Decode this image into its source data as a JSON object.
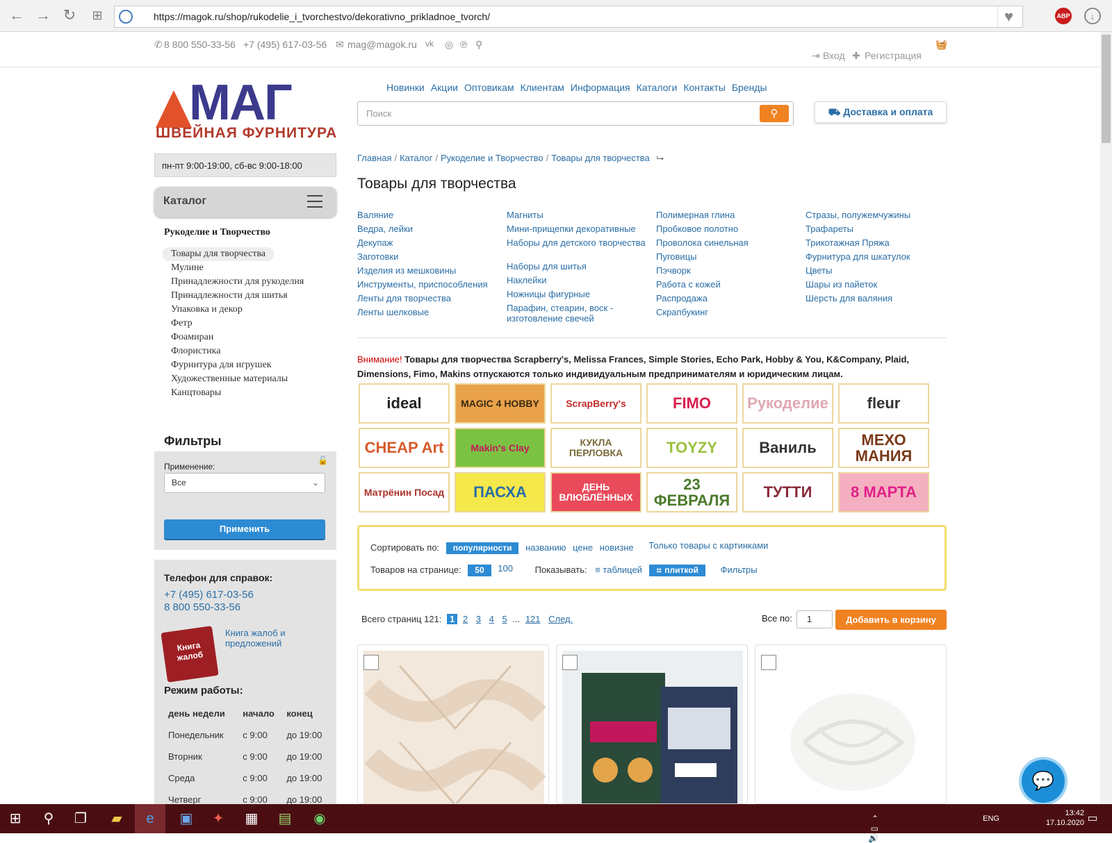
{
  "browser": {
    "url": "https://magok.ru/shop/rukodelie_i_tvorchestvo/dekorativno_prikladnoe_tvorch/",
    "abp_label": "ABP"
  },
  "topbar": {
    "phone1": "8 800 550-33-56",
    "phone2": "+7 (495) 617-03-56",
    "email": "mag@magok.ru",
    "login": "Вход",
    "register": "Регистрация"
  },
  "logo": {
    "main": "МАГ",
    "sub": "ШВЕЙНАЯ ФУРНИТУРА"
  },
  "mainmenu": [
    "Новинки",
    "Акции",
    "Оптовикам",
    "Клиентам",
    "Информация",
    "Каталоги",
    "Контакты",
    "Бренды"
  ],
  "search": {
    "placeholder": "Поиск"
  },
  "delivery": "Доставка и оплата",
  "hours": "пн-пт 9:00-19:00, сб-вс 9:00-18:00",
  "catalog": {
    "label": "Каталог"
  },
  "sidebar": {
    "title": "Рукоделие и Творчество",
    "items": [
      "Товары для творчества",
      "Мулине",
      "Принадлежности для рукоделия",
      "Принадлежности для шитья",
      "Упаковка и декор",
      "Фетр",
      "Фоамиран",
      "Флористика",
      "Фурнитура для игрушек",
      "Художественные материалы",
      "Канцтовары"
    ]
  },
  "filters": {
    "title": "Фильтры",
    "label": "Применение:",
    "selected": "Все",
    "apply": "Применить"
  },
  "contacts": {
    "title": "Телефон для справок:",
    "phone1": "+7 (495) 617-03-56",
    "phone2": "8 800 550-33-56",
    "book_image": "Книга жалоб",
    "book_link": "Книга жалоб и предложений",
    "work_title": "Режим работы:",
    "table_headers": [
      "день недели",
      "начало",
      "конец"
    ],
    "rows": [
      [
        "Понедельник",
        "с 9:00",
        "до 19:00"
      ],
      [
        "Вторник",
        "с 9:00",
        "до 19:00"
      ],
      [
        "Среда",
        "с 9:00",
        "до 19:00"
      ],
      [
        "Четверг",
        "с 9:00",
        "до 19:00"
      ]
    ]
  },
  "breadcrumb": [
    "Главная",
    "Каталог",
    "Рукоделие и Творчество",
    "Товары для творчества"
  ],
  "page_title": "Товары для творчества",
  "subcategories": [
    [
      "Валяние",
      "Ведра, лейки",
      "Декупаж",
      "Заготовки",
      "Изделия из мешковины",
      "Инструменты, приспособления",
      "Ленты для творчества",
      "Ленты шелковые"
    ],
    [
      "Магниты",
      "Мини-прищепки декоративные",
      "Наборы для детского творчества",
      "Наборы для шитья",
      "Наклейки",
      "Ножницы фигурные",
      "Парафин, стеарин, воск - изготовление свечей"
    ],
    [
      "Полимерная глина",
      "Пробковое полотно",
      "Проволока синельная",
      "Пуговицы",
      "Пэчворк",
      "Работа с кожей",
      "Распродажа",
      "Скрапбукинг"
    ],
    [
      "Стразы, полужемчужины",
      "Трафареты",
      "Трикотажная Пряжа",
      "Фурнитура для шкатулок",
      "Цветы",
      "Шары из пайеток",
      "Шерсть для валяния"
    ]
  ],
  "warning": {
    "prefix": "Внимание!",
    "text": " Товары для творчества Scrapberry's, Melissa Frances, Simple Stories, Echo Park, Hobby & You, K&Company, Plaid, Dimensions, Fimo, Makins отпускаются только индивидуальным предпринимателям и юридическим лицам."
  },
  "brands": [
    {
      "name": "ideal",
      "bg": "#ffffff",
      "color": "#222222"
    },
    {
      "name": "MAGIC 4 HOBBY",
      "bg": "#e9a24a",
      "color": "#3a2a10"
    },
    {
      "name": "ScrapBerry's",
      "bg": "#ffffff",
      "color": "#c42a2a"
    },
    {
      "name": "FIMO",
      "bg": "#ffffff",
      "color": "#d8204f"
    },
    {
      "name": "Рукоделие",
      "bg": "#ffffff",
      "color": "#e0a8b2"
    },
    {
      "name": "fleur",
      "bg": "#ffffff",
      "color": "#333333"
    },
    {
      "name": "CHEAP Art",
      "bg": "#ffffff",
      "color": "#d85a2a"
    },
    {
      "name": "Makin's Clay",
      "bg": "#7cc242",
      "color": "#c2185b"
    },
    {
      "name": "КУКЛА ПЕРЛОВКА",
      "bg": "#ffffff",
      "color": "#7a6a3a"
    },
    {
      "name": "TOYZY",
      "bg": "#ffffff",
      "color": "#9ac23c"
    },
    {
      "name": "Ваниль",
      "bg": "#ffffff",
      "color": "#333333"
    },
    {
      "name": "МЕХО МАНИЯ",
      "bg": "#ffffff",
      "color": "#7a3a1a"
    },
    {
      "name": "Матрёнин Посад",
      "bg": "#ffffff",
      "color": "#a8322a"
    },
    {
      "name": "ПАСХА",
      "bg": "#f5e84a",
      "color": "#2a6ea6"
    },
    {
      "name": "ДЕНЬ ВЛЮБЛЁННЫХ",
      "bg": "#e94b5a",
      "color": "#ffffff"
    },
    {
      "name": "23 ФЕВРАЛЯ",
      "bg": "#ffffff",
      "color": "#4a7a2a"
    },
    {
      "name": "ТУТТИ",
      "bg": "#ffffff",
      "color": "#8a2a3a"
    },
    {
      "name": "8 МАРТА",
      "bg": "#f4b0c0",
      "color": "#e0208a"
    }
  ],
  "sort": {
    "label": "Сортировать по:",
    "options": [
      "популярности",
      "названию",
      "цене",
      "новизне"
    ],
    "images_only": "Только товары с картинками",
    "per_page_label": "Товаров на странице:",
    "per_page": [
      "50",
      "100"
    ],
    "show_label": "Показывать:",
    "view_table": "таблицей",
    "view_tile": "плиткой",
    "filters_link": "Фильтры"
  },
  "pager": {
    "label": "Всего страниц 121:",
    "pages": [
      "1",
      "2",
      "3",
      "4",
      "5"
    ],
    "ellipsis": "...",
    "last": "121",
    "next": "След."
  },
  "bulk": {
    "label": "Все по:",
    "qty": "1",
    "button": "Добавить в корзину"
  },
  "taskbar": {
    "lang": "ENG",
    "time": "13:42",
    "date": "17.10.2020"
  }
}
